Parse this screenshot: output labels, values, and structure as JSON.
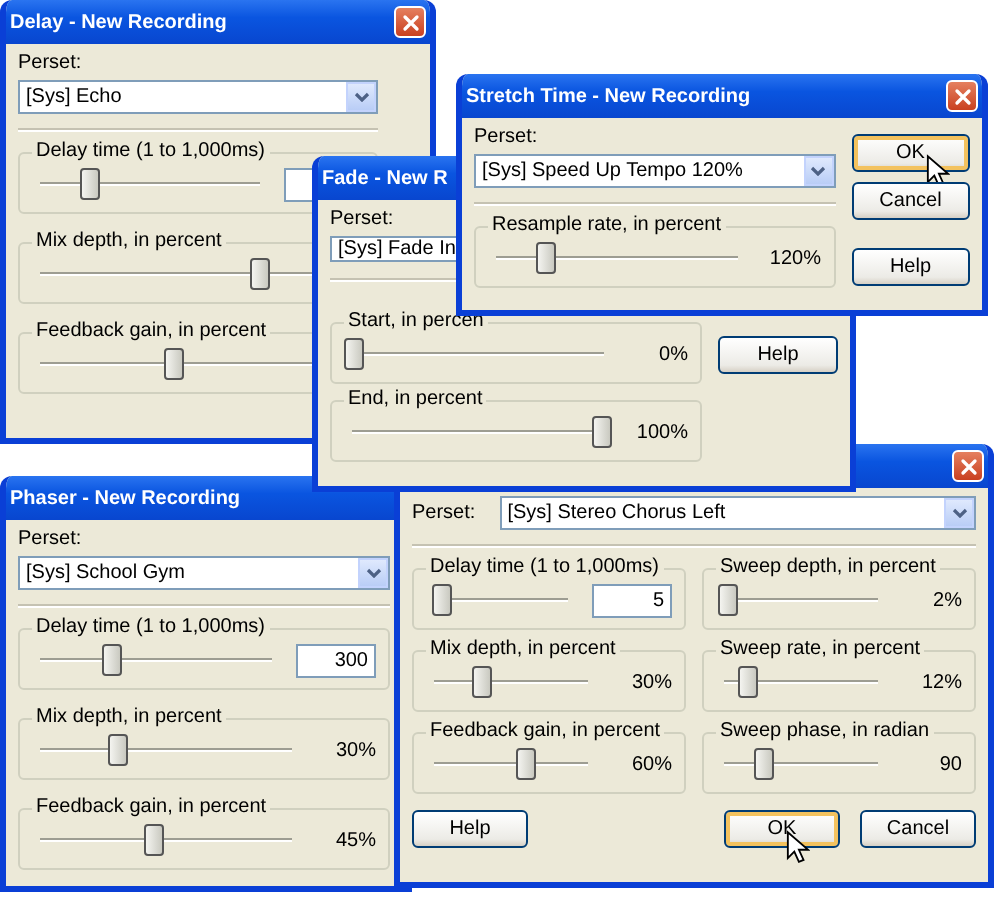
{
  "windows": [
    {
      "kind": "stacked",
      "title": "Delay - New Recording",
      "close": true,
      "preset_label": "Perset:",
      "preset": "[Sys] Echo",
      "groups": [
        {
          "label": "Delay time (1 to 1,000ms)",
          "level": 0.22,
          "readout": {
            "kind": "field"
          }
        },
        {
          "label": "Mix depth, in percent",
          "level": 0.7
        },
        {
          "label": "Feedback gain, in percent",
          "level": 0.42
        }
      ]
    },
    {
      "kind": "stacked",
      "title": "Stretch Time - New Recording",
      "close": true,
      "preset_label": "Perset:",
      "preset": "[Sys] Speed Up Tempo 120%",
      "groups": [
        {
          "label": "Resample rate, in percent",
          "level": 0.2,
          "readout": {
            "kind": "text",
            "value": "120%"
          }
        }
      ],
      "buttons": [
        {
          "label": "OK",
          "default": true,
          "cursor": true
        },
        {
          "label": "Cancel",
          "default": false,
          "cursor": false
        },
        {
          "label": "Help",
          "default": false,
          "cursor": false
        }
      ]
    },
    {
      "kind": "stacked",
      "title": "Fade - New R",
      "close": false,
      "preset_label": "Perset:",
      "preset": "[Sys] Fade In",
      "groups": [
        {
          "label": "Start, in percen",
          "level": 0,
          "readout": {
            "kind": "text",
            "value": "0%"
          }
        },
        {
          "label": "End, in percent",
          "level": 1,
          "readout": {
            "kind": "text",
            "value": "100%"
          }
        }
      ],
      "buttons": [
        {
          "label": "Help",
          "default": false,
          "cursor": false
        }
      ]
    },
    {
      "kind": "stacked",
      "title": "Phaser - New Recording",
      "close": false,
      "preset_label": "Perset:",
      "preset": "[Sys] School Gym",
      "groups": [
        {
          "label": "Delay time (1 to 1,000ms)",
          "level": 0.31,
          "readout": {
            "kind": "field",
            "value": "300"
          }
        },
        {
          "label": "Mix depth, in percent",
          "level": 0.31,
          "readout": {
            "kind": "text",
            "value": "30%"
          }
        },
        {
          "label": "Feedback gain, in percent",
          "level": 0.45,
          "readout": {
            "kind": "text",
            "value": "45%"
          }
        }
      ]
    },
    {
      "kind": "grid",
      "close": true,
      "preset_label": "Perset:",
      "preset": "[Sys] Stereo Chorus Left",
      "groups": [
        {
          "label": "Delay time (1 to 1,000ms)",
          "level": 0.05,
          "readout": {
            "kind": "field",
            "value": "5"
          }
        },
        {
          "label": "Sweep depth, in percent",
          "level": 0.02,
          "readout": {
            "kind": "text",
            "value": "2%"
          }
        },
        {
          "label": "Mix depth, in percent",
          "level": 0.3,
          "readout": {
            "kind": "text",
            "value": "30%"
          }
        },
        {
          "label": "Sweep rate, in percent",
          "level": 0.14,
          "readout": {
            "kind": "text",
            "value": "12%"
          }
        },
        {
          "label": "Feedback gain, in percent",
          "level": 0.6,
          "readout": {
            "kind": "text",
            "value": "60%"
          }
        },
        {
          "label": "Sweep phase, in radian",
          "level": 0.26,
          "readout": {
            "kind": "text",
            "value": "90"
          }
        }
      ],
      "buttons": [
        {
          "label": "Help",
          "default": false,
          "cursor": false
        },
        {
          "label": "OK",
          "default": true,
          "cursor": true
        },
        {
          "label": "Cancel",
          "default": false,
          "cursor": false
        }
      ]
    }
  ]
}
